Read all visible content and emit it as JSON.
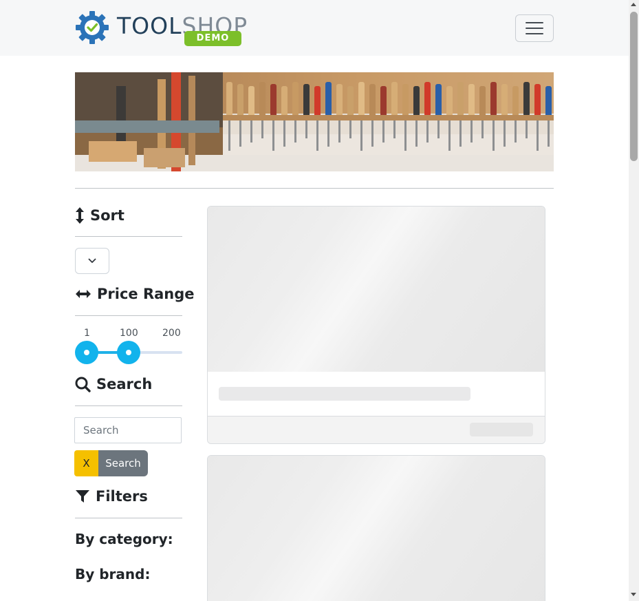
{
  "navbar": {
    "logo_word_tool": "TOOL",
    "logo_word_shop": "SHOP",
    "logo_badge": "DEMO",
    "menu_toggle": "hamburger-menu-icon"
  },
  "sidebar": {
    "sort": {
      "heading": "Sort",
      "icon": "sort-arrows-icon",
      "select_value": ""
    },
    "price_range": {
      "heading": "Price Range",
      "icon": "horizontal-arrows-icon",
      "labels": [
        "1",
        "100",
        "200"
      ],
      "min_value": 1,
      "max_value": 100,
      "range_min": 1,
      "range_max": 200
    },
    "search": {
      "heading": "Search",
      "icon": "magnifier-icon",
      "placeholder": "Search",
      "clear_label": "X",
      "submit_label": "Search"
    },
    "filters": {
      "heading": "Filters",
      "icon": "funnel-icon",
      "by_category": "By category:",
      "by_brand": "By brand:"
    }
  },
  "colors": {
    "accent_blue": "#12b3ec",
    "clear_button": "#f5c000",
    "search_button": "#6c757d",
    "logo_green": "#7cbf2a"
  }
}
